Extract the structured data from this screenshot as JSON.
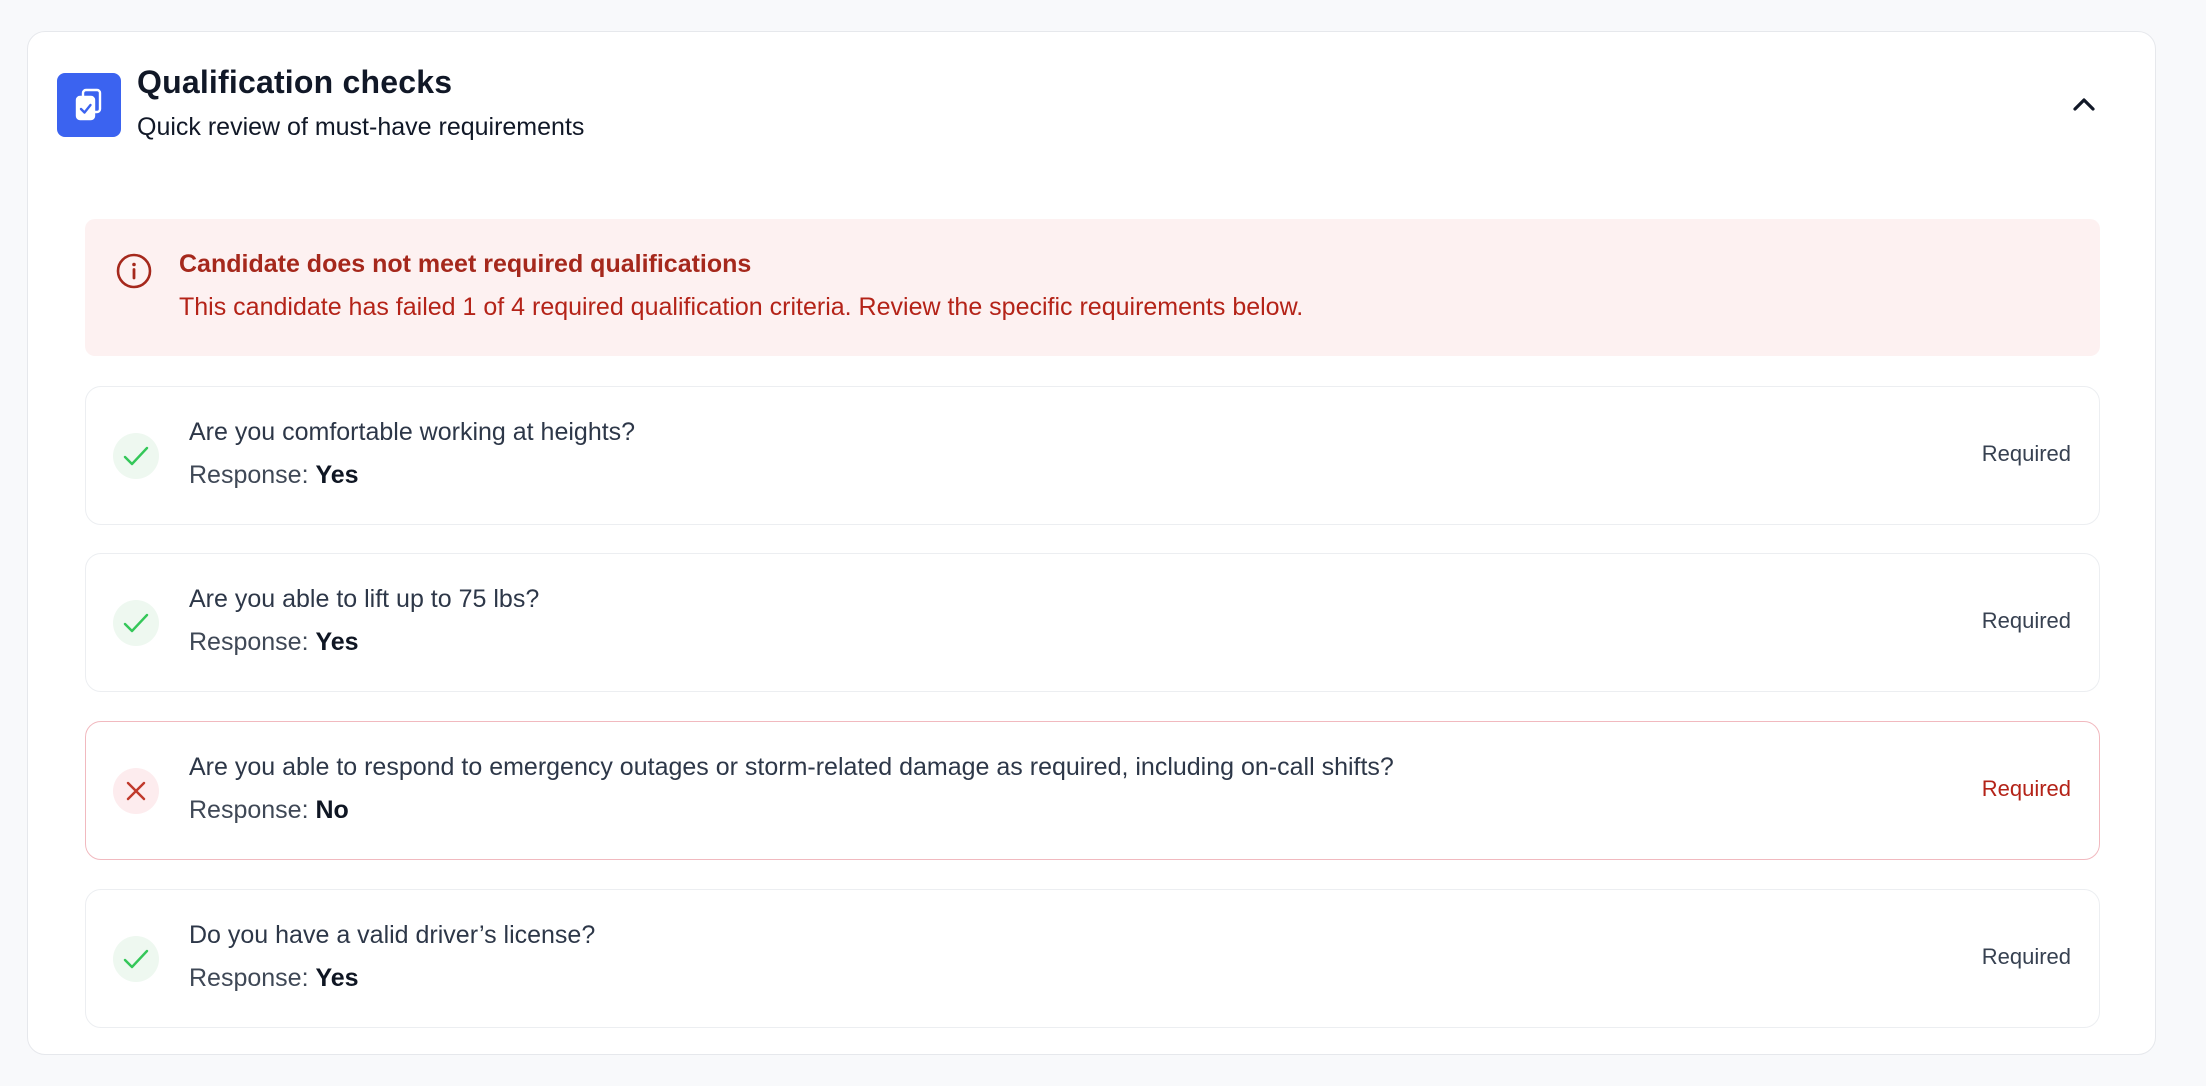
{
  "header": {
    "title": "Qualification checks",
    "subtitle": "Quick review of must-have requirements",
    "icon": "clipboard-check-icon",
    "collapse_icon": "chevron-up-icon"
  },
  "alert": {
    "title": "Candidate does not meet required qualifications",
    "message": "This candidate has failed 1 of 4 required qualification criteria. Review the specific requirements below.",
    "icon": "info-circle-icon"
  },
  "questions": [
    {
      "question": "Are you comfortable working at heights?",
      "response_label": "Response:",
      "response": "Yes",
      "status": "pass",
      "badge": "Required"
    },
    {
      "question": "Are you able to lift up to 75 lbs?",
      "response_label": "Response:",
      "response": "Yes",
      "status": "pass",
      "badge": "Required"
    },
    {
      "question": "Are you able to respond to emergency outages or storm-related damage as required, including on-call shifts?",
      "response_label": "Response:",
      "response": "No",
      "status": "fail",
      "badge": "Required"
    },
    {
      "question": "Do you have a valid driver’s license?",
      "response_label": "Response:",
      "response": "Yes",
      "status": "pass",
      "badge": "Required"
    }
  ],
  "colors": {
    "accent": "#3b63f0",
    "pass": "#34c759",
    "fail": "#c0392b",
    "alert_bg": "#fdf1f1",
    "alert_text": "#b42318"
  }
}
